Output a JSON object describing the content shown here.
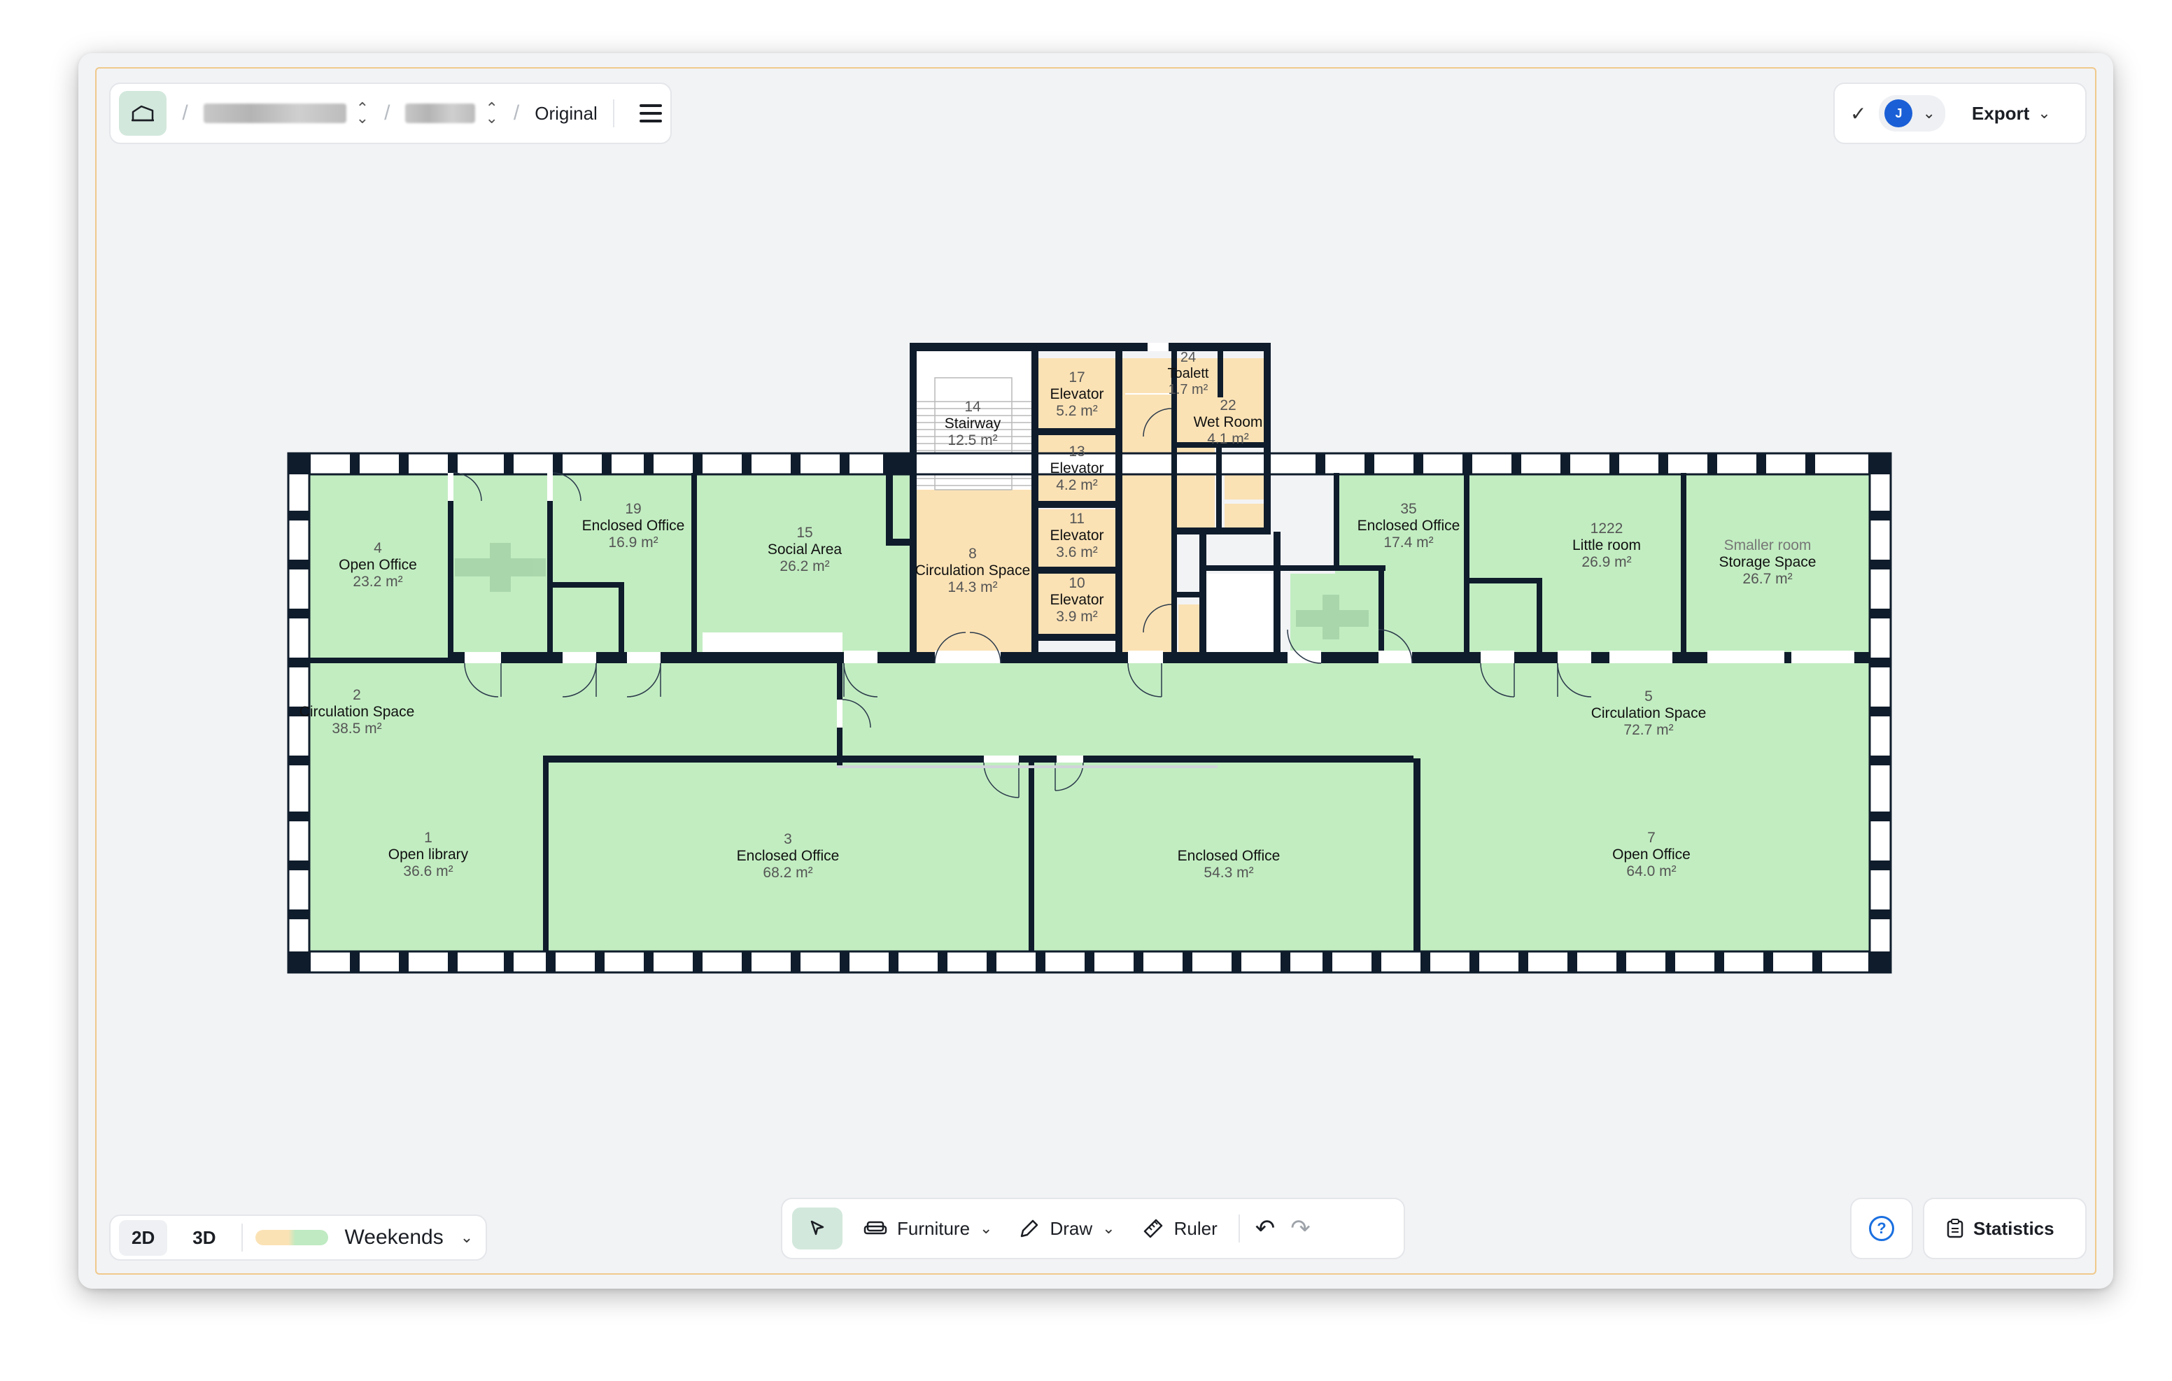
{
  "toolbar": {
    "crumb_current": "Original"
  },
  "top_right": {
    "avatar_initial": "J",
    "export_label": "Export"
  },
  "view": {
    "mode_2d": "2D",
    "mode_3d": "3D",
    "schedule": "Weekends"
  },
  "tools": {
    "furniture": "Furniture",
    "draw": "Draw",
    "ruler": "Ruler"
  },
  "stats_label": "Statistics",
  "colors": {
    "occupied_green": "#c2edc1",
    "core_orange": "#fbe2b5",
    "wall": "#0f1c2b",
    "frame": "#f0c98c",
    "accent_blue": "#1a5fd6"
  },
  "rooms": {
    "r4": {
      "num": "4",
      "name": "Open Office",
      "area": "23.2 m²"
    },
    "r19": {
      "num": "19",
      "name": "Enclosed Office",
      "area": "16.9 m²"
    },
    "r15": {
      "num": "15",
      "name": "Social Area",
      "area": "26.2 m²"
    },
    "r14": {
      "num": "14",
      "name": "Stairway",
      "area": "12.5 m²"
    },
    "r8": {
      "num": "8",
      "name": "Circulation Space",
      "area": "14.3 m²"
    },
    "r17": {
      "num": "17",
      "name": "Elevator",
      "area": "5.2 m²"
    },
    "r13": {
      "num": "13",
      "name": "Elevator",
      "area": "4.2 m²"
    },
    "r11": {
      "num": "11",
      "name": "Elevator",
      "area": "3.6 m²"
    },
    "r10": {
      "num": "10",
      "name": "Elevator",
      "area": "3.9 m²"
    },
    "r24": {
      "num": "24",
      "name": "Toalett",
      "area": "1.7 m²"
    },
    "r22": {
      "num": "22",
      "name": "Wet Room",
      "area": "4.1 m²"
    },
    "r35": {
      "num": "35",
      "name": "Enclosed Office",
      "area": "17.4 m²"
    },
    "r1222": {
      "num": "1222",
      "name": "Little room",
      "area": "26.9 m²"
    },
    "rsm": {
      "num": "Smaller room",
      "name": "Storage Space",
      "area": "26.7 m²"
    },
    "r2": {
      "num": "2",
      "name": "Circulation Space",
      "area": "38.5 m²"
    },
    "r5": {
      "num": "5",
      "name": "Circulation Space",
      "area": "72.7 m²"
    },
    "r1": {
      "num": "1",
      "name": "Open library",
      "area": "36.6 m²"
    },
    "r3": {
      "num": "3",
      "name": "Enclosed Office",
      "area": "68.2 m²"
    },
    "rEO": {
      "name": "Enclosed Office",
      "area": "54.3 m²"
    },
    "r7": {
      "num": "7",
      "name": "Open Office",
      "area": "64.0 m²"
    }
  }
}
